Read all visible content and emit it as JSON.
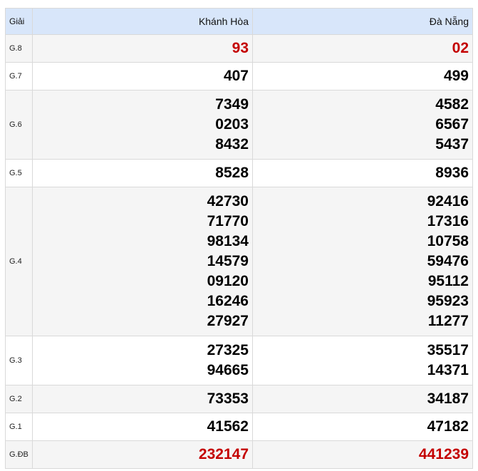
{
  "header": {
    "prize_label": "Giải",
    "provinces": [
      "Khánh Hòa",
      "Đà Nẵng"
    ]
  },
  "rows": [
    {
      "label": "G.8",
      "highlight": true,
      "values": [
        [
          "93"
        ],
        [
          "02"
        ]
      ]
    },
    {
      "label": "G.7",
      "highlight": false,
      "values": [
        [
          "407"
        ],
        [
          "499"
        ]
      ]
    },
    {
      "label": "G.6",
      "highlight": false,
      "values": [
        [
          "7349",
          "0203",
          "8432"
        ],
        [
          "4582",
          "6567",
          "5437"
        ]
      ]
    },
    {
      "label": "G.5",
      "highlight": false,
      "values": [
        [
          "8528"
        ],
        [
          "8936"
        ]
      ]
    },
    {
      "label": "G.4",
      "highlight": false,
      "values": [
        [
          "42730",
          "71770",
          "98134",
          "14579",
          "09120",
          "16246",
          "27927"
        ],
        [
          "92416",
          "17316",
          "10758",
          "59476",
          "95112",
          "95923",
          "11277"
        ]
      ]
    },
    {
      "label": "G.3",
      "highlight": false,
      "values": [
        [
          "27325",
          "94665"
        ],
        [
          "35517",
          "14371"
        ]
      ]
    },
    {
      "label": "G.2",
      "highlight": false,
      "values": [
        [
          "73353"
        ],
        [
          "34187"
        ]
      ]
    },
    {
      "label": "G.1",
      "highlight": false,
      "values": [
        [
          "41562"
        ],
        [
          "47182"
        ]
      ]
    },
    {
      "label": "G.ĐB",
      "highlight": true,
      "values": [
        [
          "232147"
        ],
        [
          "441239"
        ]
      ]
    }
  ],
  "colors": {
    "header_bg": "#d8e6fa",
    "highlight": "#c40000",
    "alt_row_bg": "#f5f5f5",
    "border": "#d9d9d9"
  }
}
